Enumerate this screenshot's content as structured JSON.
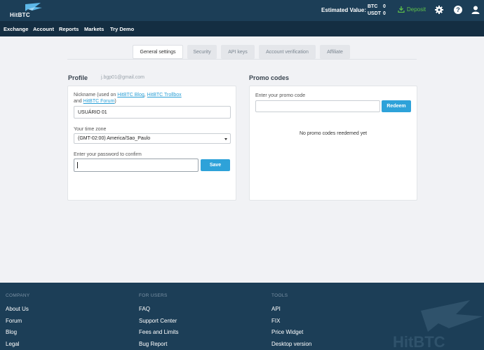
{
  "header": {
    "logo_text": "HitBTC",
    "estimated_label": "Estimated Value:",
    "balances": [
      {
        "currency": "BTC",
        "value": "0"
      },
      {
        "currency": "USDT",
        "value": "0"
      }
    ],
    "deposit_label": "Deposit",
    "icons": [
      "deposit-icon",
      "gear-icon",
      "help-icon",
      "user-icon"
    ],
    "colors": {
      "header_bg": "#1c3e57",
      "nav_bg": "#142e42",
      "accent": "#2ea2d9",
      "deposit": "#5fc24a"
    }
  },
  "nav": {
    "items": [
      "Exchange",
      "Account",
      "Reports",
      "Markets",
      "Try Demo"
    ]
  },
  "tabs": [
    "General settings",
    "Security",
    "API keys",
    "Account verification",
    "Affiliate"
  ],
  "profile": {
    "title": "Profile",
    "email": "j.bgp01@gmail.com",
    "nickname_label_prefix": "Nickname (used on ",
    "nickname_link1": "HitBTC Blog",
    "nickname_sep": ", ",
    "nickname_link2": "HitBTC Trollbox",
    "nickname_and": "and ",
    "nickname_link3": "HitBTC Forum",
    "nickname_suffix": ")",
    "nickname_value": "USUÁRIO 01",
    "timezone_label": "Your time zone",
    "timezone_value": "(GMT-02:00) America/Sao_Paulo",
    "password_label": "Enter your password to confirm",
    "password_value": "",
    "save_label": "Save"
  },
  "promo": {
    "title": "Promo codes",
    "input_label": "Enter your promo code",
    "input_value": "",
    "redeem_label": "Redeem",
    "empty_message": "No promo codes reedemed yet"
  },
  "footer": {
    "columns": [
      {
        "heading": "COMPANY",
        "links": [
          "About Us",
          "Forum",
          "Blog",
          "Legal"
        ]
      },
      {
        "heading": "FOR USERS",
        "links": [
          "FAQ",
          "Support Center",
          "Fees and Limits",
          "Bug Report"
        ]
      },
      {
        "heading": "TOOLS",
        "links": [
          "API",
          "FIX",
          "Price Widget",
          "Desktop version"
        ]
      }
    ],
    "watermark_text": "HitBTC"
  }
}
